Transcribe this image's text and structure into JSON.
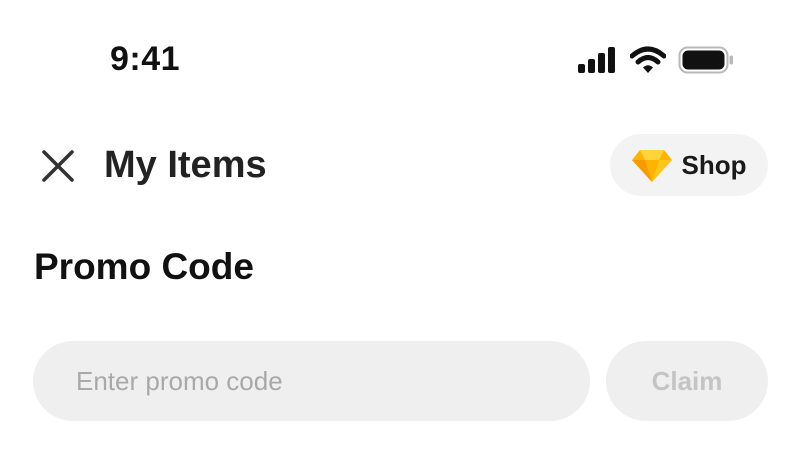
{
  "status_bar": {
    "time": "9:41",
    "icons": [
      "signal-icon",
      "wifi-icon",
      "battery-icon"
    ]
  },
  "header": {
    "close_icon": "close-icon",
    "title": "My Items",
    "shop": {
      "icon": "gem-icon",
      "label": "Shop",
      "gem_color": "#FFB300"
    }
  },
  "promo": {
    "section_title": "Promo Code",
    "input_value": "",
    "input_placeholder": "Enter promo code",
    "claim_label": "Claim",
    "claim_enabled": false
  }
}
